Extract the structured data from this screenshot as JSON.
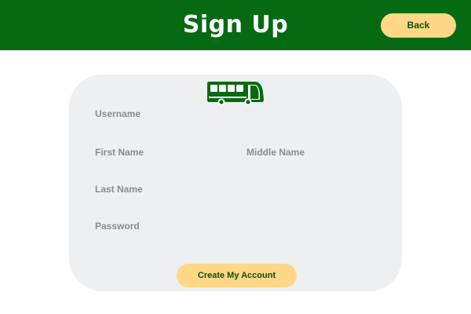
{
  "header": {
    "title": "Sign Up",
    "back_label": "Back"
  },
  "form": {
    "logo_icon": "bus-icon",
    "fields": {
      "username": {
        "label": "Username",
        "value": ""
      },
      "first_name": {
        "label": "First Name",
        "value": ""
      },
      "middle_name": {
        "label": "Middle Name",
        "value": ""
      },
      "last_name": {
        "label": "Last Name",
        "value": ""
      },
      "password": {
        "label": "Password",
        "value": ""
      }
    },
    "submit_label": "Create My Account"
  },
  "colors": {
    "brand_green": "#066a12",
    "button_yellow": "#fed886",
    "button_text": "#0e4d12",
    "card_background": "#eeeff1",
    "label_gray": "#8a8c8e"
  }
}
